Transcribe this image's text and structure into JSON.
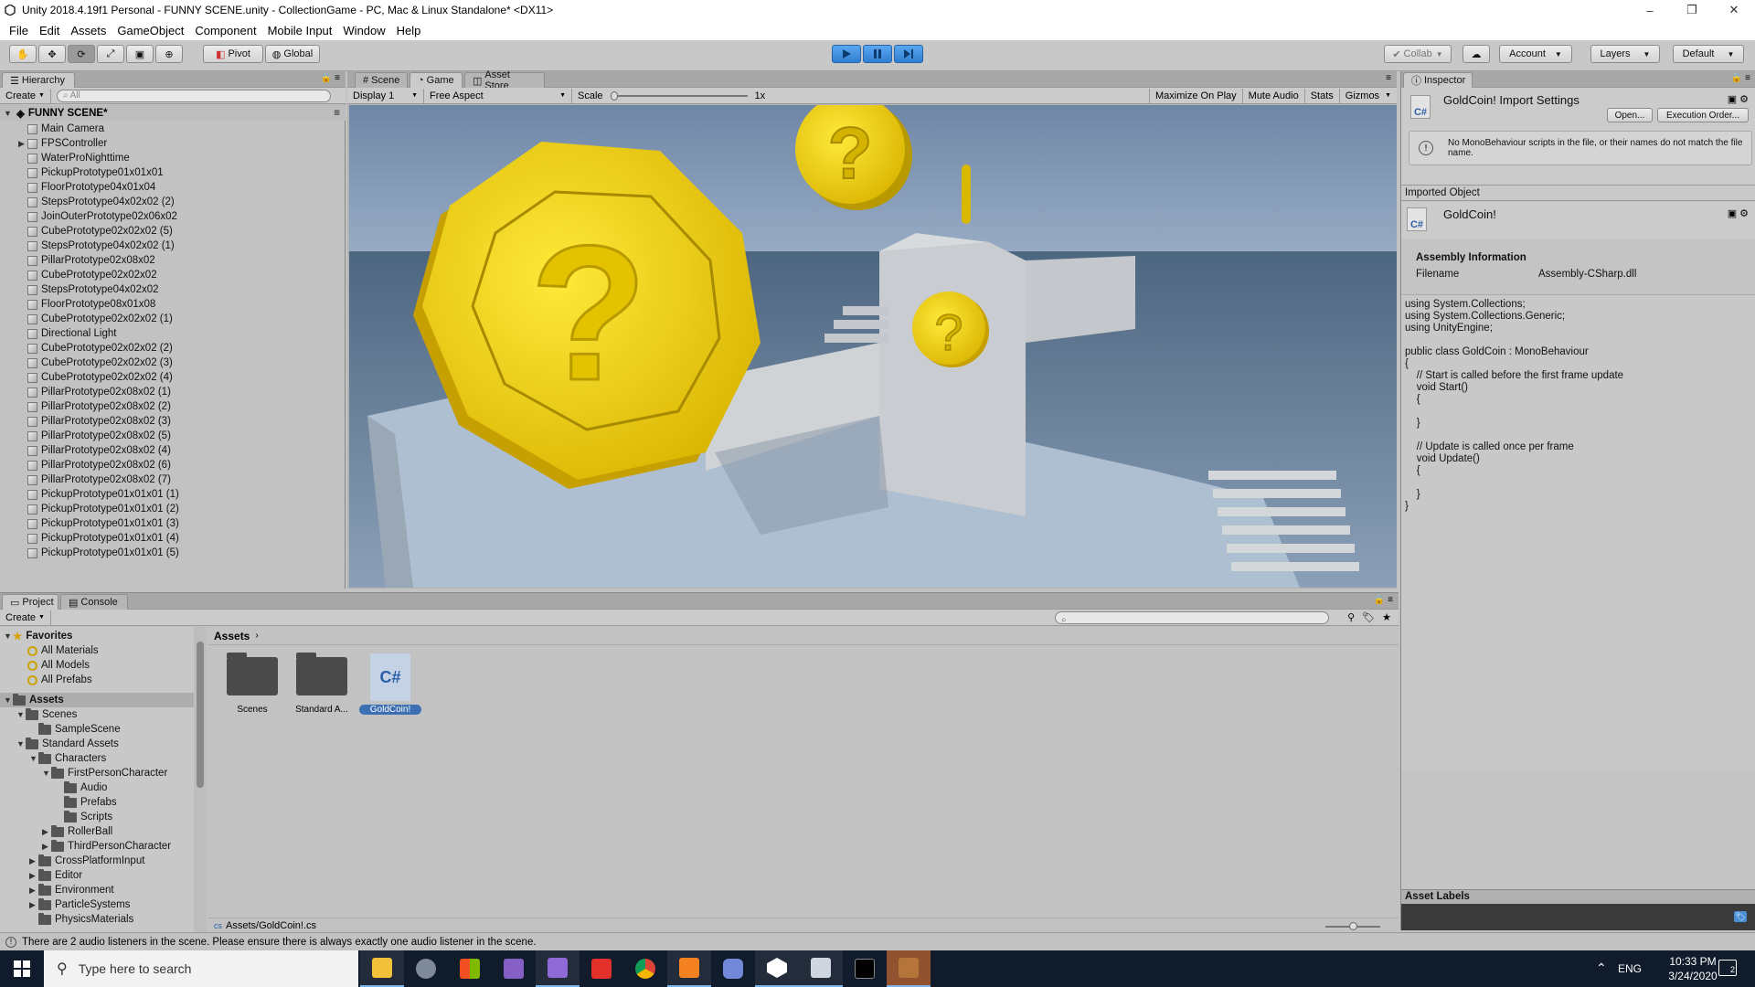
{
  "window": {
    "title": "Unity 2018.4.19f1 Personal - FUNNY SCENE.unity - CollectionGame - PC, Mac & Linux Standalone* <DX11>",
    "minimize": "–",
    "maximize": "❐",
    "close": "✕"
  },
  "menu": [
    "File",
    "Edit",
    "Assets",
    "GameObject",
    "Component",
    "Mobile Input",
    "Window",
    "Help"
  ],
  "toolbar": {
    "pivot": "Pivot",
    "global": "Global",
    "collab": "Collab",
    "account": "Account",
    "layers": "Layers",
    "layout": "Default"
  },
  "hierarchy": {
    "tab": "Hierarchy",
    "create": "Create",
    "search_placeholder": "All",
    "scene": "FUNNY SCENE*",
    "items": [
      "Main Camera",
      "FPSController",
      "WaterProNighttime",
      "PickupPrototype01x01x01",
      "FloorPrototype04x01x04",
      "StepsPrototype04x02x02 (2)",
      "JoinOuterPrototype02x06x02",
      "CubePrototype02x02x02 (5)",
      "StepsPrototype04x02x02 (1)",
      "PillarPrototype02x08x02",
      "CubePrototype02x02x02",
      "StepsPrototype04x02x02",
      "FloorPrototype08x01x08",
      "CubePrototype02x02x02 (1)",
      "Directional Light",
      "CubePrototype02x02x02 (2)",
      "CubePrototype02x02x02 (3)",
      "CubePrototype02x02x02 (4)",
      "PillarPrototype02x08x02 (1)",
      "PillarPrototype02x08x02 (2)",
      "PillarPrototype02x08x02 (3)",
      "PillarPrototype02x08x02 (5)",
      "PillarPrototype02x08x02 (4)",
      "PillarPrototype02x08x02 (6)",
      "PillarPrototype02x08x02 (7)",
      "PickupPrototype01x01x01 (1)",
      "PickupPrototype01x01x01 (2)",
      "PickupPrototype01x01x01 (3)",
      "PickupPrototype01x01x01 (4)",
      "PickupPrototype01x01x01 (5)"
    ]
  },
  "game": {
    "tabs": [
      "Scene",
      "Game",
      "Asset Store"
    ],
    "display": "Display 1",
    "aspect": "Free Aspect",
    "scale_label": "Scale",
    "scale_value": "1x",
    "maximize": "Maximize On Play",
    "mute": "Mute Audio",
    "stats": "Stats",
    "gizmos": "Gizmos"
  },
  "inspector": {
    "tab": "Inspector",
    "title": "GoldCoin! Import Settings",
    "cs": "C#",
    "open_btn": "Open...",
    "exec_btn": "Execution Order...",
    "warning": "No MonoBehaviour scripts in the file, or their names do not match the file name.",
    "imported_object": "Imported Object",
    "object_name": "GoldCoin!",
    "assembly_header": "Assembly Information",
    "filename_label": "Filename",
    "filename_value": "Assembly-CSharp.dll",
    "code": "using System.Collections;\nusing System.Collections.Generic;\nusing UnityEngine;\n\npublic class GoldCoin : MonoBehaviour\n{\n    // Start is called before the first frame update\n    void Start()\n    {\n\n    }\n\n    // Update is called once per frame\n    void Update()\n    {\n\n    }\n}",
    "asset_labels": "Asset Labels"
  },
  "project": {
    "tabs": [
      "Project",
      "Console"
    ],
    "create": "Create",
    "favorites": "Favorites",
    "fav_items": [
      "All Materials",
      "All Models",
      "All Prefabs"
    ],
    "assets": "Assets",
    "tree": [
      {
        "label": "Scenes",
        "depth": 1,
        "arrow": "▼"
      },
      {
        "label": "SampleScene",
        "depth": 2,
        "arrow": ""
      },
      {
        "label": "Standard Assets",
        "depth": 1,
        "arrow": "▼"
      },
      {
        "label": "Characters",
        "depth": 2,
        "arrow": "▼"
      },
      {
        "label": "FirstPersonCharacter",
        "depth": 3,
        "arrow": "▼"
      },
      {
        "label": "Audio",
        "depth": 4,
        "arrow": ""
      },
      {
        "label": "Prefabs",
        "depth": 4,
        "arrow": ""
      },
      {
        "label": "Scripts",
        "depth": 4,
        "arrow": ""
      },
      {
        "label": "RollerBall",
        "depth": 3,
        "arrow": "▶"
      },
      {
        "label": "ThirdPersonCharacter",
        "depth": 3,
        "arrow": "▶"
      },
      {
        "label": "CrossPlatformInput",
        "depth": 2,
        "arrow": "▶"
      },
      {
        "label": "Editor",
        "depth": 2,
        "arrow": "▶"
      },
      {
        "label": "Environment",
        "depth": 2,
        "arrow": "▶"
      },
      {
        "label": "ParticleSystems",
        "depth": 2,
        "arrow": "▶"
      },
      {
        "label": "PhysicsMaterials",
        "depth": 2,
        "arrow": ""
      }
    ],
    "breadcrumb": "Assets",
    "grid": [
      "Scenes",
      "Standard A...",
      "GoldCoin!"
    ],
    "path": "Assets/GoldCoin!.cs"
  },
  "status": "There are 2 audio listeners in the scene. Please ensure there is always exactly one audio listener in the scene.",
  "taskbar": {
    "search_placeholder": "Type here to search",
    "lang": "ENG",
    "time": "10:33 PM",
    "date": "3/24/2020",
    "notif": "2"
  },
  "colors": {
    "coin": "#e8c800",
    "play_active": "#3d8fe0"
  }
}
